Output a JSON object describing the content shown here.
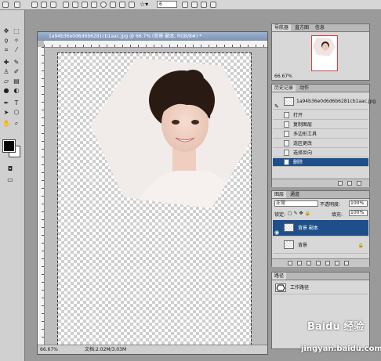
{
  "options_bar": {
    "tolerance_value": "6"
  },
  "document": {
    "title": "1a94b36e0d6d6b6281cb1aac.jpg @ 66.7% (背景 副本, RGB/8#) *",
    "zoom": "66.67%",
    "file_info": "文档:2.02M/3.03M"
  },
  "navigator": {
    "tabs": [
      "导航器",
      "直方图",
      "信息"
    ],
    "zoom": "66.67%"
  },
  "history": {
    "tabs": [
      "历史记录",
      "动作"
    ],
    "snapshot_label": "1a94b36e0d6d6b6281cb1aac.jpg",
    "items": [
      "打开",
      "复制图层",
      "多边形工具",
      "选区更改",
      "选择反向",
      "删除"
    ],
    "selected_index": 5
  },
  "layers": {
    "tabs": [
      "图层",
      "通道"
    ],
    "blend_mode": "正常",
    "opacity_label": "不透明度:",
    "opacity_value": "100%",
    "lock_label": "锁定:",
    "fill_label": "填充:",
    "fill_value": "100%",
    "items": [
      {
        "name": "背景 副本",
        "visible": true,
        "selected": true
      },
      {
        "name": "背景",
        "visible": false,
        "selected": false
      }
    ]
  },
  "actions_panel": {
    "tabs": [
      "路径"
    ],
    "item": "工作路径"
  },
  "watermark": {
    "brand": "Baidu 经验",
    "url": "jingyan.baidu.com"
  },
  "colors": {
    "selection_blue": "#1f4f8a",
    "title_bar": "#7d92b4",
    "panel_bg": "#d8d8d8"
  }
}
